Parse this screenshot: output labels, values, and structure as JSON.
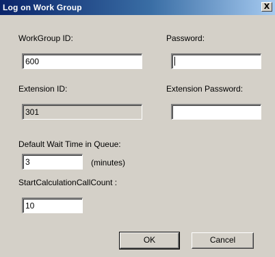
{
  "window": {
    "title": "Log on Work Group",
    "close_label": "X"
  },
  "form": {
    "workgroup_id": {
      "label": "WorkGroup ID:",
      "value": "600"
    },
    "password": {
      "label": "Password:",
      "value": ""
    },
    "extension_id": {
      "label": "Extension ID:",
      "value": "301"
    },
    "extension_password": {
      "label": "Extension Password:",
      "value": ""
    },
    "default_wait": {
      "label": "Default Wait Time in Queue:",
      "value": "3",
      "unit": "(minutes)"
    },
    "start_calc": {
      "label": "StartCalculationCallCount :",
      "value": "10"
    }
  },
  "buttons": {
    "ok": "OK",
    "cancel": "Cancel"
  }
}
